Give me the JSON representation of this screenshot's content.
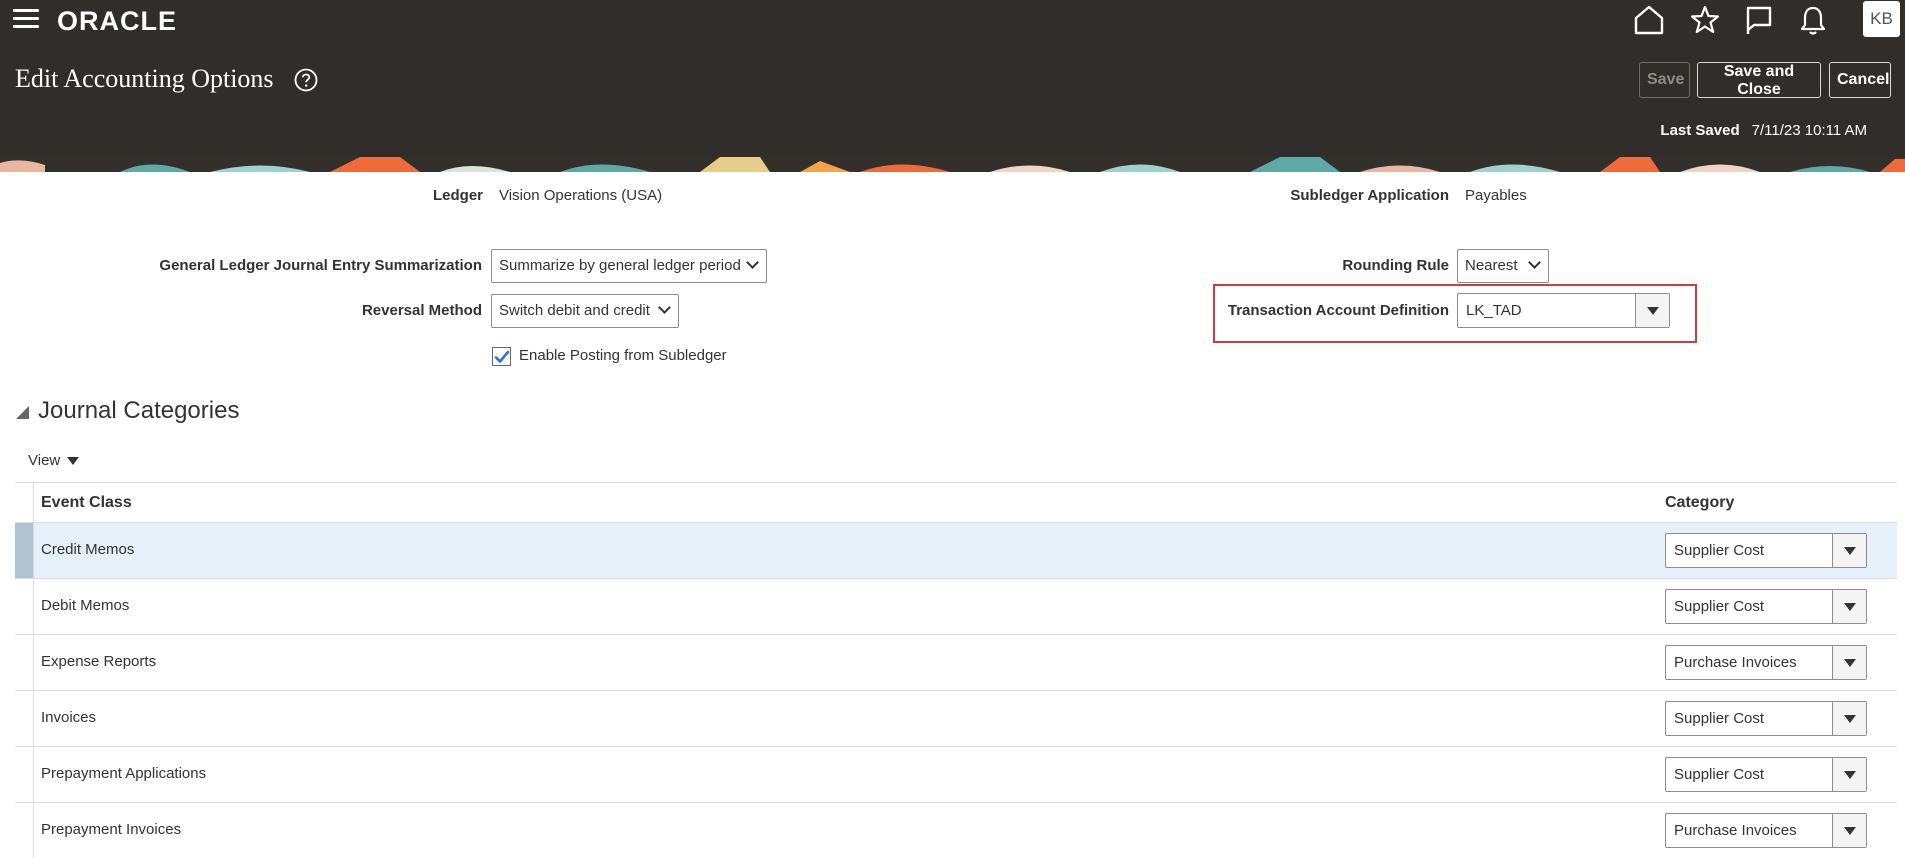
{
  "header": {
    "brand": "ORACLE",
    "icons": [
      "home-icon",
      "favorites-star-icon",
      "notifications-flag-icon",
      "bell-icon"
    ],
    "user_initials": "KB",
    "page_title": "Edit Accounting Options",
    "buttons": {
      "save": "Save",
      "save_and_close": "Save and Close",
      "cancel": "Cancel"
    },
    "last_saved_label": "Last Saved",
    "last_saved_value": "7/11/23 10:11 AM"
  },
  "form": {
    "ledger_label": "Ledger",
    "ledger_value": "Vision Operations (USA)",
    "subledger_label": "Subledger Application",
    "subledger_value": "Payables",
    "gl_summarization_label": "General Ledger Journal Entry Summarization",
    "gl_summarization_value": "Summarize by general ledger period",
    "reversal_method_label": "Reversal Method",
    "reversal_method_value": "Switch debit and credit",
    "rounding_rule_label": "Rounding Rule",
    "rounding_rule_value": "Nearest",
    "tad_label": "Transaction Account Definition",
    "tad_value": "LK_TAD",
    "enable_posting_label": "Enable Posting from Subledger",
    "enable_posting_checked": true
  },
  "journal_categories": {
    "title": "Journal Categories",
    "view_menu": "View",
    "columns": {
      "event_class": "Event Class",
      "category": "Category"
    },
    "rows": [
      {
        "event_class": "Credit Memos",
        "category": "Supplier Cost",
        "selected": true
      },
      {
        "event_class": "Debit Memos",
        "category": "Supplier Cost"
      },
      {
        "event_class": "Expense Reports",
        "category": "Purchase Invoices"
      },
      {
        "event_class": "Invoices",
        "category": "Supplier Cost"
      },
      {
        "event_class": "Prepayment Applications",
        "category": "Supplier Cost"
      },
      {
        "event_class": "Prepayment Invoices",
        "category": "Purchase Invoices"
      }
    ]
  },
  "colors": {
    "header_bg": "#312d2a",
    "highlight_border": "#d63b3b",
    "selected_row": "#e6f1fa"
  }
}
